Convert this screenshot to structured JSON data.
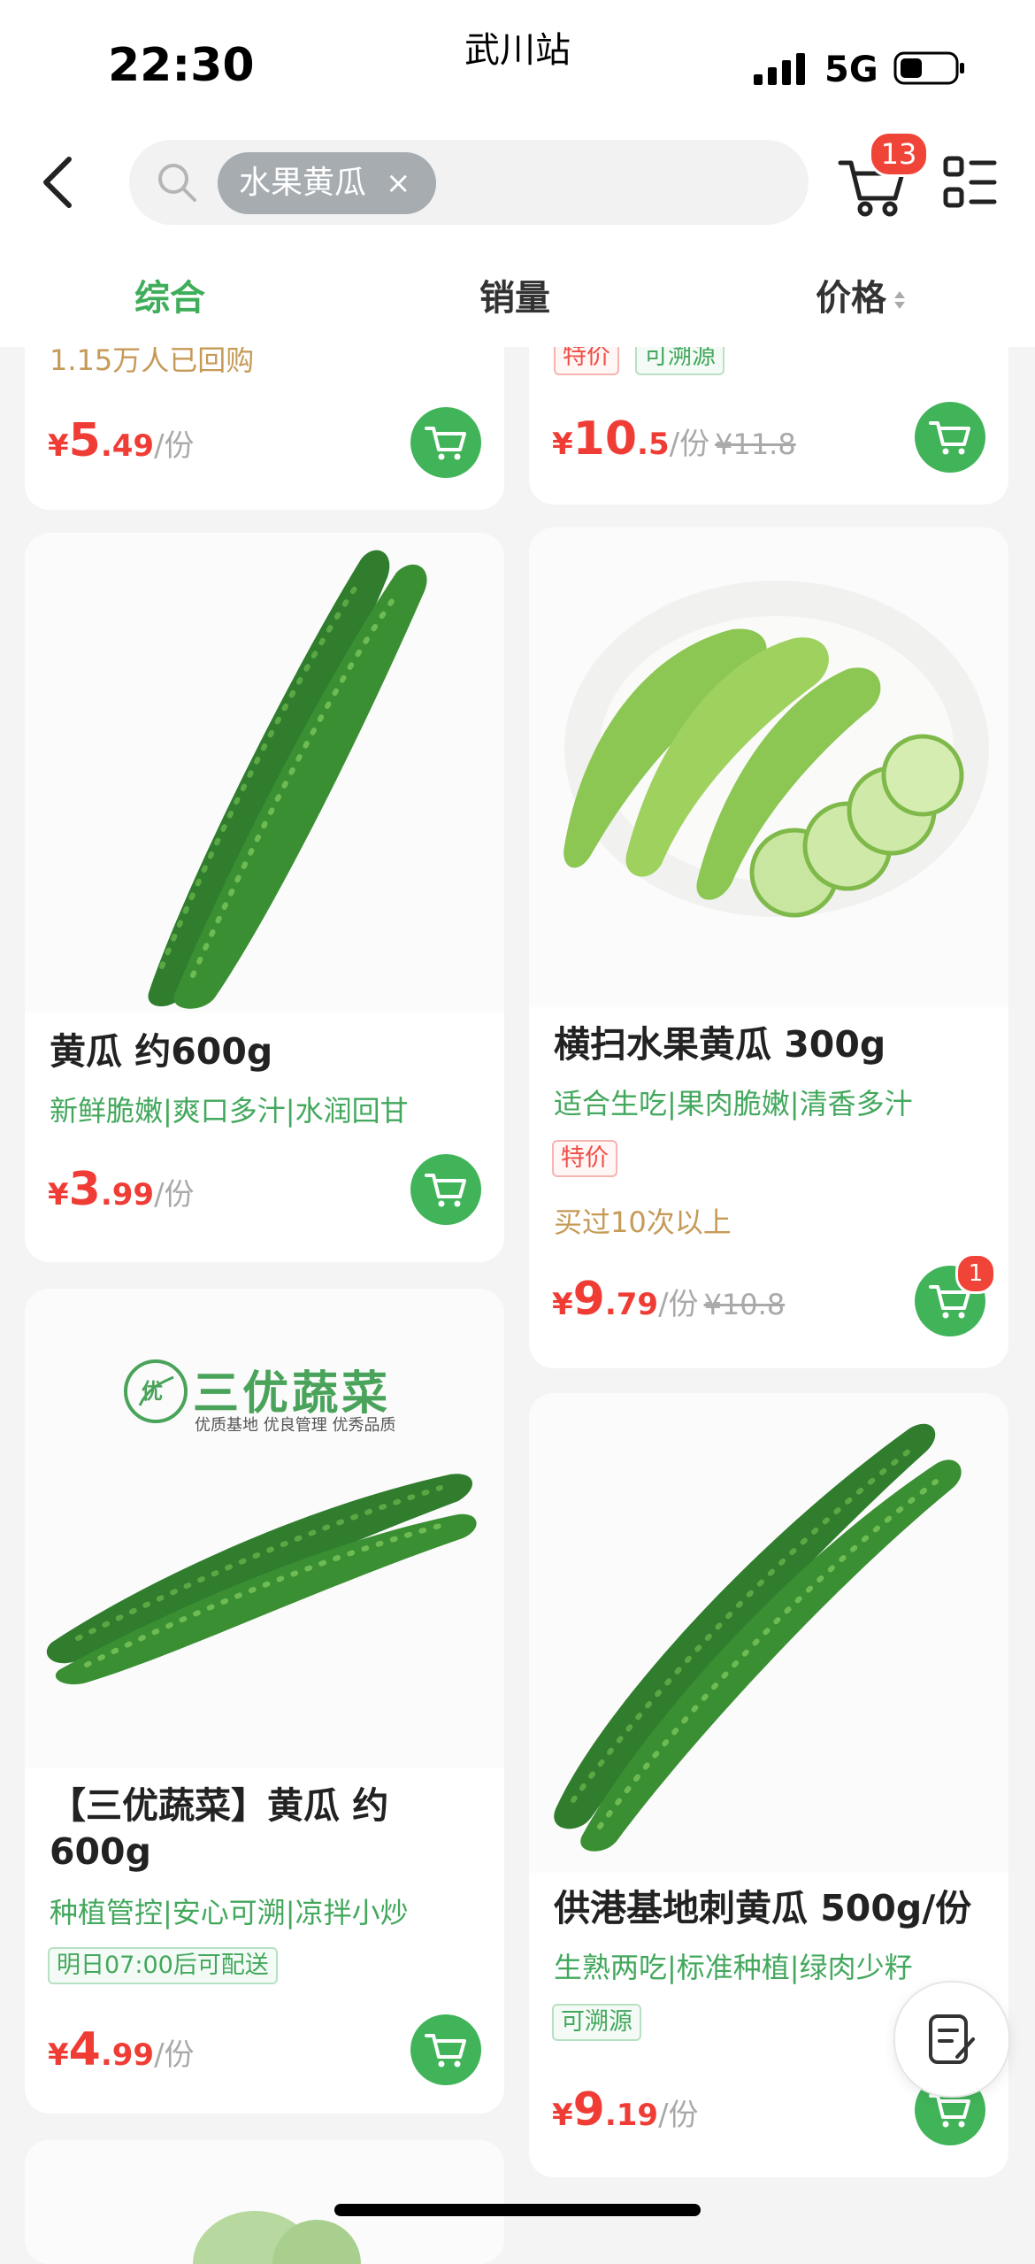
{
  "status_bar": {
    "time": "22:30",
    "station": "武川站",
    "network": "5G"
  },
  "search": {
    "chip_text": "水果黄瓜",
    "chip_close": "×"
  },
  "cart": {
    "badge_count": "13"
  },
  "tabs": {
    "comprehensive": "综合",
    "sales": "销量",
    "price": "价格"
  },
  "colors": {
    "accent_green": "#41b45a",
    "price_red": "#ef3d35",
    "tag_red": "#ef4e45",
    "feature_green": "#43a85d",
    "rebuy_gold": "#c69a57"
  },
  "products": [
    {
      "rebuy": "1.15万人已回购",
      "price": {
        "currency": "¥",
        "int": "5",
        "dec": ".49",
        "unit": "/份"
      }
    },
    {
      "tags": [
        "特价",
        "可溯源"
      ],
      "price": {
        "currency": "¥",
        "int": "10",
        "dec": ".5",
        "unit": "/份",
        "original": "¥11.8"
      }
    },
    {
      "title": "黄瓜 约600g",
      "features": "新鲜脆嫩|爽口多汁|水润回甘",
      "price": {
        "currency": "¥",
        "int": "3",
        "dec": ".99",
        "unit": "/份"
      }
    },
    {
      "title": "横扫水果黄瓜 300g",
      "features": "适合生吃|果肉脆嫩|清香多汁",
      "tags": [
        "特价"
      ],
      "rebuy": "买过10次以上",
      "price": {
        "currency": "¥",
        "int": "9",
        "dec": ".79",
        "unit": "/份",
        "original": "¥10.8"
      },
      "in_cart": "1"
    },
    {
      "brand_name": "三优蔬菜",
      "brand_slogan": "优质基地 优良管理 优秀品质",
      "brand_mark": "优",
      "title": "【三优蔬菜】黄瓜 约600g",
      "features": "种植管控|安心可溯|凉拌小炒",
      "tags": [
        "明日07:00后可配送"
      ],
      "price": {
        "currency": "¥",
        "int": "4",
        "dec": ".99",
        "unit": "/份"
      }
    },
    {
      "title": "供港基地刺黄瓜 500g/份",
      "features": "生熟两吃|标准种植|绿肉少籽",
      "tags": [
        "可溯源"
      ],
      "price": {
        "currency": "¥",
        "int": "9",
        "dec": ".19",
        "unit": "/份"
      }
    }
  ]
}
